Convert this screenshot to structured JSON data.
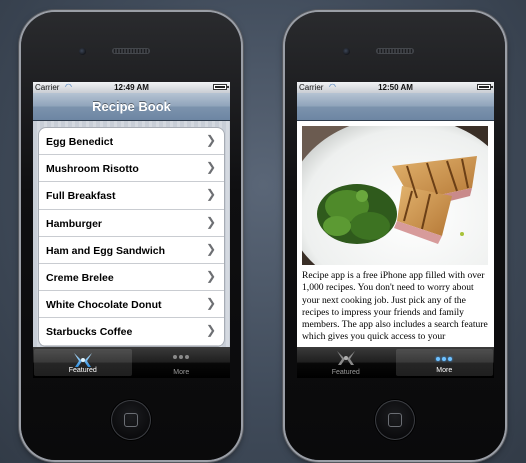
{
  "left_screen": {
    "status": {
      "carrier": "Carrier",
      "time": "12:49 AM",
      "battery_level": 0.9
    },
    "title": "Recipe Book",
    "recipes": [
      "Egg Benedict",
      "Mushroom Risotto",
      "Full Breakfast",
      "Hamburger",
      "Ham and Egg Sandwich",
      "Creme Brelee",
      "White Chocolate Donut",
      "Starbucks Coffee"
    ],
    "tabs": [
      {
        "label": "Featured",
        "icon": "featured-icon",
        "selected": true
      },
      {
        "label": "More",
        "icon": "more-dots-icon",
        "selected": false
      }
    ]
  },
  "right_screen": {
    "status": {
      "carrier": "Carrier",
      "time": "12:50 AM",
      "battery_level": 0.9
    },
    "title": "",
    "description": "Recipe app is a free iPhone app filled with over 1,000 recipes. You don't need to worry about your next cooking job. Just pick any of the recipes to impress your friends and family members. The app also includes a search feature which gives you quick access to your",
    "tabs": [
      {
        "label": "Featured",
        "icon": "featured-icon",
        "selected": false
      },
      {
        "label": "More",
        "icon": "more-dots-icon",
        "selected": true
      }
    ]
  },
  "colors": {
    "nav_bar": "#7c93ad",
    "tab_selected_blue": "#6fc2ff",
    "list_background": "#c8ced7"
  }
}
